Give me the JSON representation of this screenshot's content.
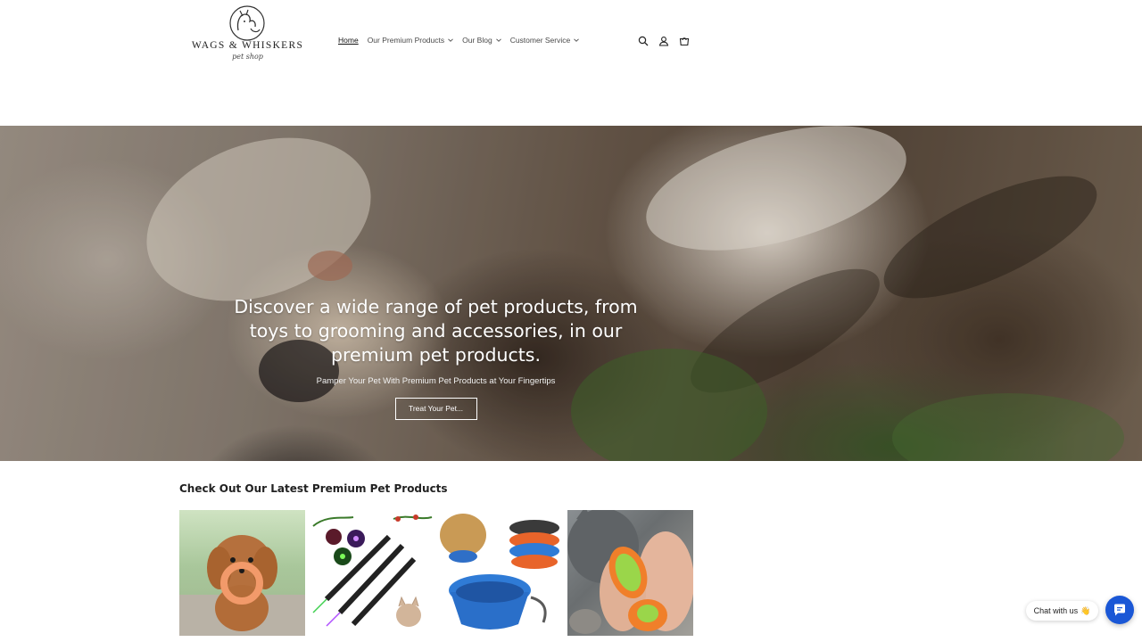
{
  "brand": {
    "name": "WAGS & WHISKERS",
    "tagline": "pet shop"
  },
  "nav": {
    "items": [
      {
        "label": "Home",
        "active": true,
        "has_dropdown": false
      },
      {
        "label": "Our Premium Products",
        "active": false,
        "has_dropdown": true
      },
      {
        "label": "Our Blog",
        "active": false,
        "has_dropdown": true
      },
      {
        "label": "Customer Service",
        "active": false,
        "has_dropdown": true
      }
    ]
  },
  "header_icons": [
    "search-icon",
    "account-icon",
    "cart-icon"
  ],
  "hero": {
    "title": "Discover a wide range of pet products, from toys to grooming and accessories, in our premium pet products.",
    "subtitle": "Pamper Your Pet With Premium Pet Products at Your Fingertips",
    "button_label": "Treat Your Pet..."
  },
  "products_section": {
    "title": "Check Out Our Latest Premium Pet Products",
    "products": [
      {
        "image": "poodle-with-ring-toy"
      },
      {
        "image": "laser-pointer-toys"
      },
      {
        "image": "collapsible-pet-bowls"
      },
      {
        "image": "cat-grooming-brush"
      }
    ]
  },
  "chat": {
    "label": "Chat with us",
    "emoji": "👋",
    "accent": "#1a57d6"
  }
}
